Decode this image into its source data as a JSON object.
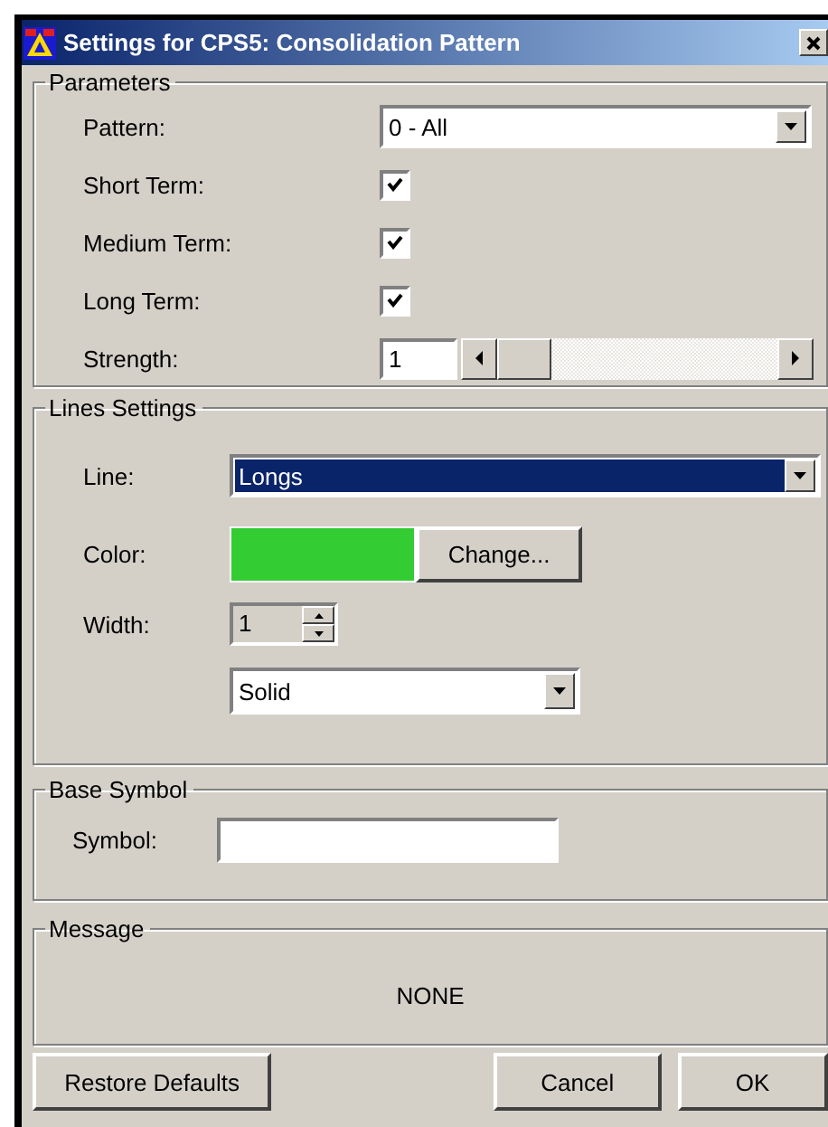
{
  "window": {
    "title": "Settings for CPS5: Consolidation Pattern"
  },
  "parameters": {
    "title": "Parameters",
    "pattern": {
      "label": "Pattern:",
      "value": "0 - All"
    },
    "terms": [
      {
        "label": "Short Term:",
        "checked": true
      },
      {
        "label": "Medium Term:",
        "checked": true
      },
      {
        "label": "Long Term:",
        "checked": true
      }
    ],
    "strength": {
      "label": "Strength:",
      "value": "1",
      "level": 0
    }
  },
  "lines_settings": {
    "title": "Lines Settings",
    "line": {
      "label": "Line:",
      "value": "Longs",
      "focused": true
    },
    "color": {
      "label": "Color:",
      "color": "#33cc33",
      "button": "Change..."
    },
    "width": {
      "label": "Width:",
      "value": "1"
    },
    "style": {
      "value": "Solid"
    }
  },
  "base_symbol": {
    "title": "Base Symbol",
    "label": "Symbol:"
  },
  "message": {
    "title": "Message",
    "text": "NONE"
  },
  "buttons": [
    {
      "label": "Restore Defaults"
    },
    {
      "label": "Cancel"
    },
    {
      "label": "OK"
    }
  ]
}
